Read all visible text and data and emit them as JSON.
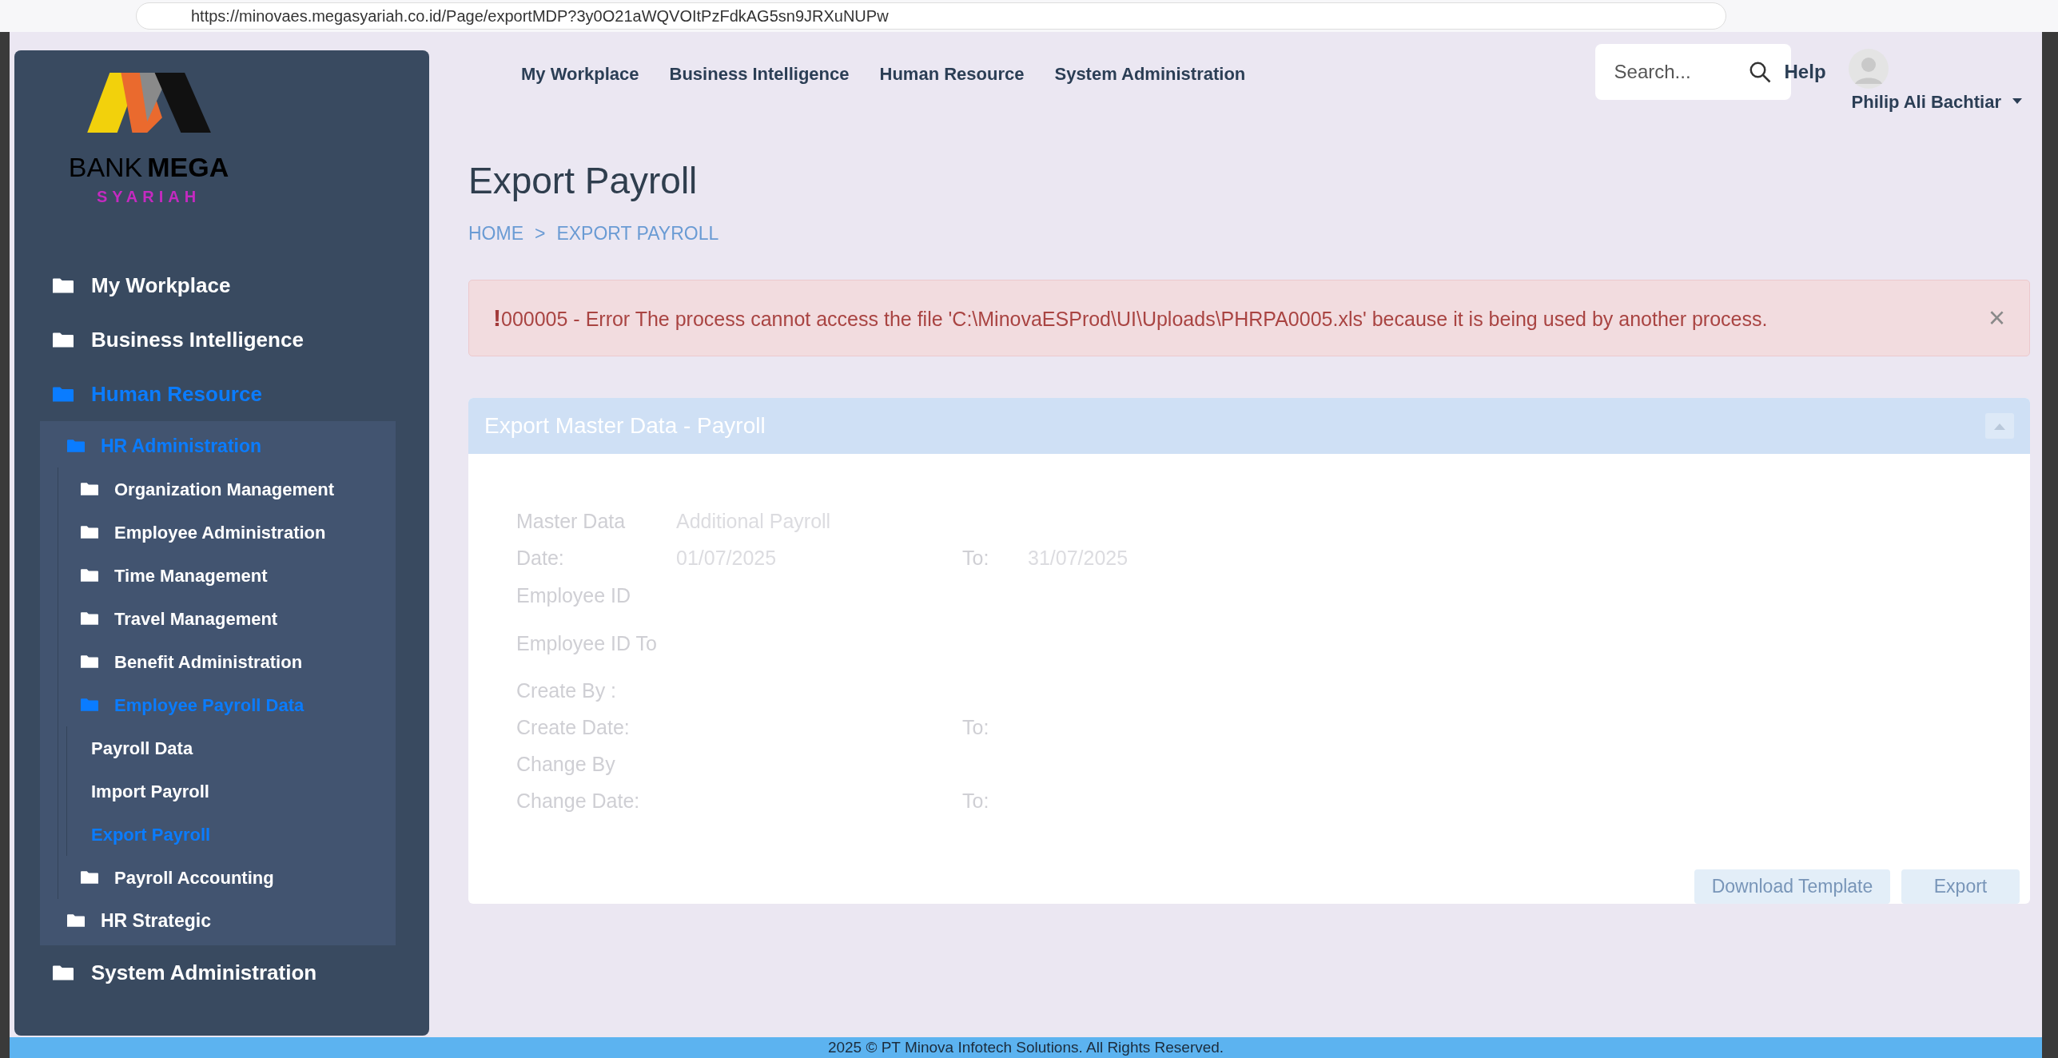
{
  "browser": {
    "url": "https://minovaes.megasyariah.co.id/Page/exportMDP?3y0O21aWQVOItPzFdkAG5sn9JRXuNUPw"
  },
  "logo": {
    "word_1": "BANK",
    "word_2": "MEGA",
    "word_3": "SYARIAH"
  },
  "sidebar": {
    "items": [
      {
        "label": "My Workplace",
        "selected": false
      },
      {
        "label": "Business Intelligence",
        "selected": false
      },
      {
        "label": "Human Resource",
        "selected": true,
        "children": [
          {
            "label": "HR Administration",
            "selected": true,
            "children": [
              {
                "label": "Organization Management",
                "selected": false
              },
              {
                "label": "Employee Administration",
                "selected": false
              },
              {
                "label": "Time Management",
                "selected": false
              },
              {
                "label": "Travel Management",
                "selected": false
              },
              {
                "label": "Benefit Administration",
                "selected": false
              },
              {
                "label": "Employee Payroll Data",
                "selected": true,
                "children": [
                  {
                    "label": "Payroll Data",
                    "selected": false
                  },
                  {
                    "label": "Import Payroll",
                    "selected": false
                  },
                  {
                    "label": "Export Payroll",
                    "selected": true
                  }
                ]
              },
              {
                "label": "Payroll Accounting",
                "selected": false
              }
            ]
          },
          {
            "label": "HR Strategic",
            "selected": false
          }
        ]
      },
      {
        "label": "System Administration",
        "selected": false
      }
    ]
  },
  "top_nav": {
    "items": [
      "My Workplace",
      "Business Intelligence",
      "Human Resource",
      "System Administration"
    ],
    "search": {
      "placeholder": "Search..."
    },
    "help": "Help",
    "user": "Philip Ali Bachtiar"
  },
  "page": {
    "title": "Export Payroll",
    "breadcrumb": [
      "HOME",
      ">",
      "EXPORT PAYROLL"
    ]
  },
  "alert": {
    "mark": "!",
    "message": "000005 - Error The process cannot access the file 'C:\\MinovaESProd\\UI\\Uploads\\PHRPA0005.xls' because it is being used by another process.",
    "close": "×"
  },
  "panel": {
    "title": "Export Master Data - Payroll",
    "rows": [
      {
        "label": "Master Data",
        "value": "Additional Payroll"
      },
      {
        "label": "Date:",
        "value": "01/07/2025",
        "to_label": "To:",
        "to_value": "31/07/2025"
      },
      {
        "label": "Employee ID"
      },
      {
        "label": "Employee ID To"
      },
      {
        "label": "Create By :"
      },
      {
        "label": "Create Date:",
        "to_label": "To:"
      },
      {
        "label": "Change By"
      },
      {
        "label": "Change Date:",
        "to_label": "To:"
      }
    ],
    "buttons": [
      "Download Template",
      "Export"
    ]
  },
  "footer": "2025 © PT Minova Infotech Solutions. All Rights Reserved."
}
